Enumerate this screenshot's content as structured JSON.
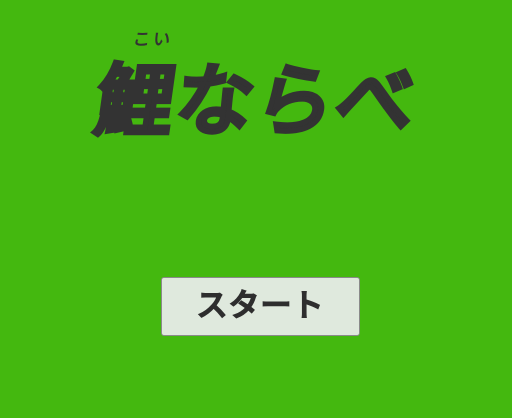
{
  "game": {
    "title": "鯉ならべ",
    "title_ruby": "こい",
    "start_label": "スタート"
  },
  "colors": {
    "background": "#44b80f",
    "text": "#333333",
    "button_background": "#dfe9dd",
    "button_text": "#2e2e2e"
  }
}
